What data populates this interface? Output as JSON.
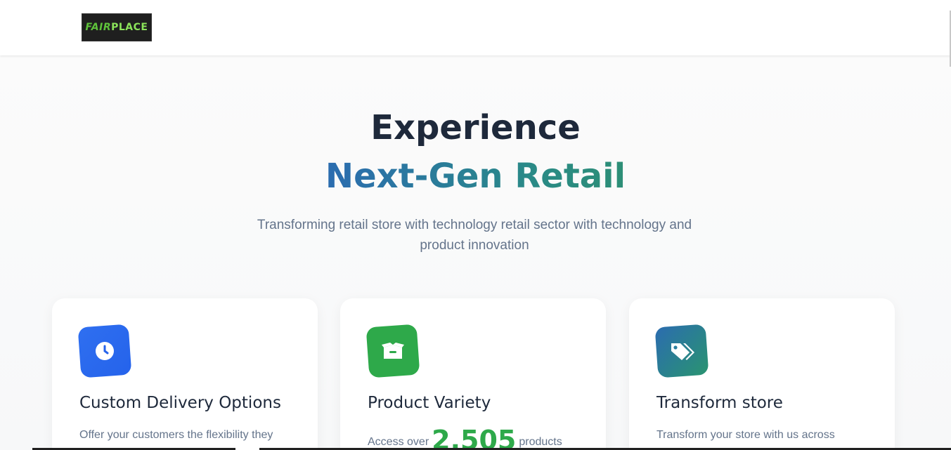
{
  "header": {
    "logo": {
      "text_fair": "FAIR",
      "text_place": "PLACE",
      "colors": {
        "fair": "#5ec23a",
        "place": "#8be35a",
        "background": "#1f1f1f"
      }
    }
  },
  "hero": {
    "headline_line1": "Experience",
    "headline_line2": "Next-Gen Retail",
    "subtitle": "Transforming retail store with technology retail sector with technology and product innovation",
    "gradient_colors": [
      "#2b6cb0",
      "#2a8a86",
      "#2d8e76"
    ]
  },
  "features": [
    {
      "icon": "clock-icon",
      "icon_color": "#2563eb",
      "title": "Custom Delivery Options",
      "text": "Offer your customers the flexibility they need..."
    },
    {
      "icon": "box-icon",
      "icon_color": "#2ea94a",
      "title": "Product Variety",
      "text_before": "Access over",
      "count": "2,505",
      "text_after": "products"
    },
    {
      "icon": "tags-icon",
      "icon_color": "#2a9470",
      "title": "Transform store",
      "text": "Transform your store with us across various..."
    }
  ]
}
